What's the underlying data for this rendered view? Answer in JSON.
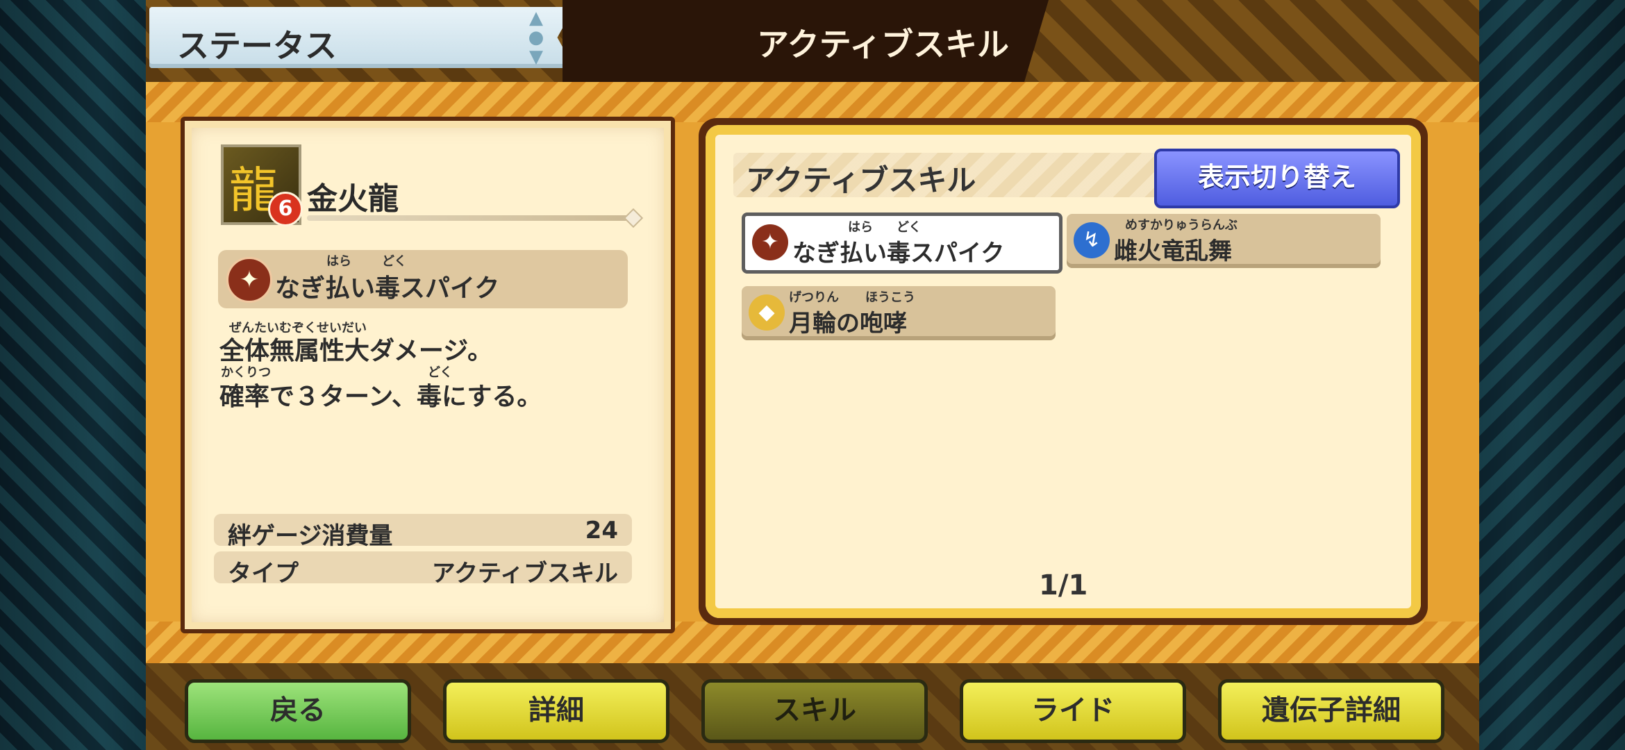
{
  "header": {
    "status_title": "ステータス",
    "section_title": "アクティブスキル"
  },
  "monster": {
    "name": "金火龍",
    "badge": "6"
  },
  "selected_skill": {
    "name": "なぎ払い毒スパイク",
    "ruby_1": "はら",
    "ruby_2": "どく",
    "desc_ruby_1": "ぜんたいむぞくせいだい",
    "desc_line1": "全体無属性大ダメージ。",
    "desc_ruby_2": "かくりつ",
    "desc_ruby_3": "どく",
    "desc_line2": "確率で３ターン、毒にする。",
    "cost_label": "絆ゲージ消費量",
    "cost_value": "24",
    "type_label": "タイプ",
    "type_value": "アクティブスキル"
  },
  "skill_list": {
    "title": "アクティブスキル",
    "toggle_button": "表示切り替え",
    "items": [
      {
        "name": "なぎ払い毒スパイク",
        "ruby_1": "はら",
        "ruby_2": "どく"
      },
      {
        "name": "雌火竜乱舞",
        "ruby_1": "めすかりゅうらんぶ"
      },
      {
        "name": "月輪の咆哮",
        "ruby_1": "げつりん",
        "ruby_2": "ほうこう"
      }
    ],
    "page": "1/1"
  },
  "buttons": {
    "back": "戻る",
    "detail": "詳細",
    "skill": "スキル",
    "ride": "ライド",
    "gene_detail": "遺伝子詳細"
  }
}
